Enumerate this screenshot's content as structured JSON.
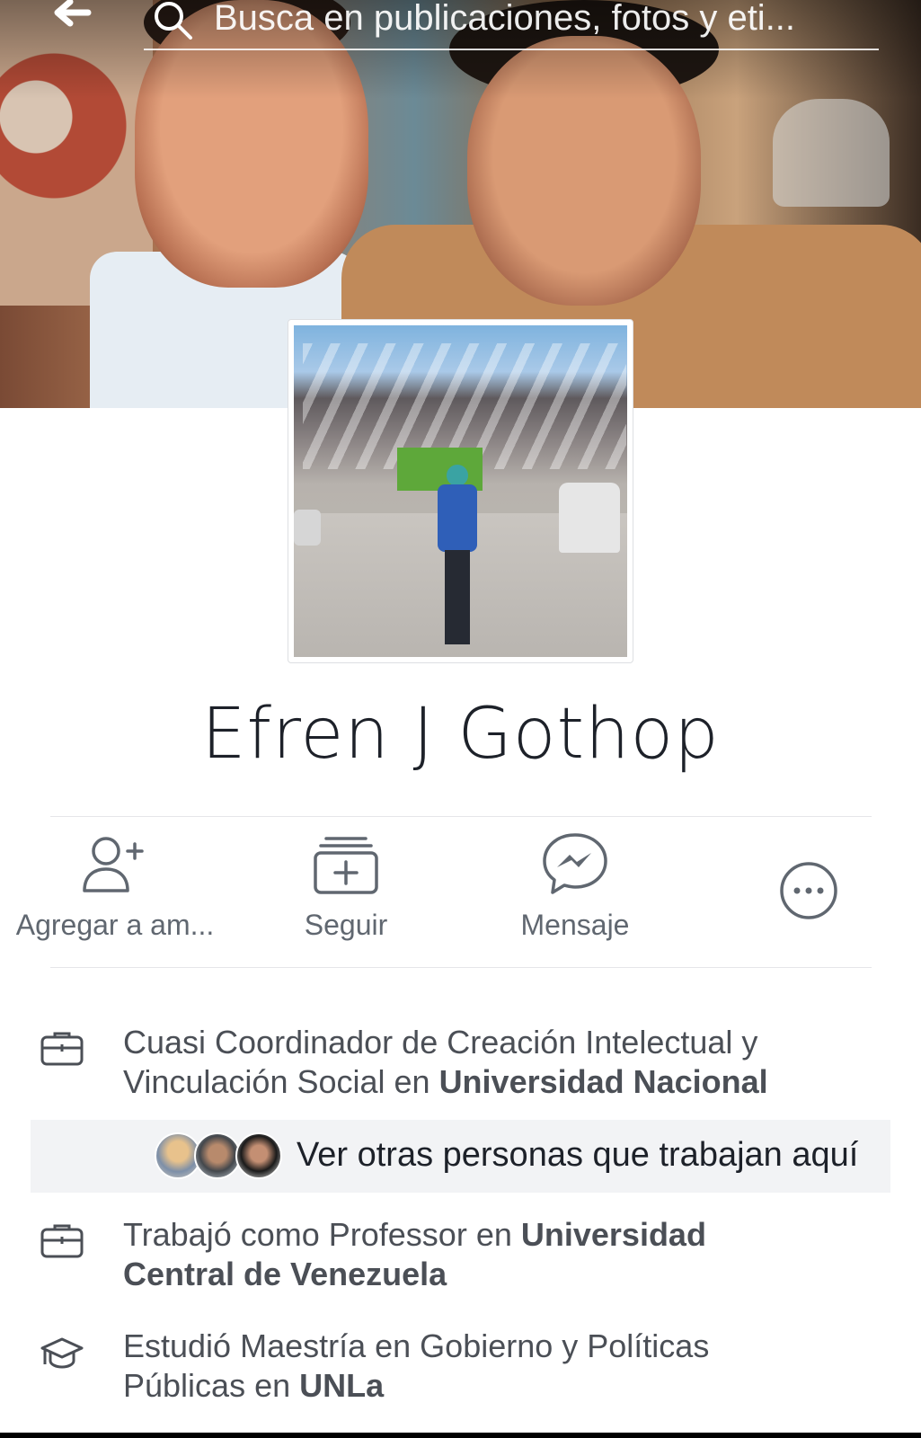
{
  "search": {
    "placeholder": "Busca en publicaciones, fotos y eti..."
  },
  "profile": {
    "name": "Efren J Gothop"
  },
  "actions": [
    {
      "label": "Agregar a am...",
      "icon": "add-friend-icon"
    },
    {
      "label": "Seguir",
      "icon": "follow-icon"
    },
    {
      "label": "Mensaje",
      "icon": "messenger-icon"
    },
    {
      "label": "",
      "icon": "more-icon"
    }
  ],
  "about": {
    "work_current": {
      "text_prefix": "Cuasi Coordinador de Creación Intelectual y Vinculación Social en ",
      "org": "Universidad Nacional",
      "icon": "briefcase-icon"
    },
    "coworkers_label": "Ver otras personas que trabajan aquí",
    "work_past": {
      "text_prefix": "Trabajó como Professor en ",
      "org": "Universidad Central de Venezuela",
      "icon": "briefcase-icon"
    },
    "education": {
      "text_prefix": "Estudió Maestría en Gobierno y Políticas Públicas en ",
      "org": "UNLa",
      "icon": "graduation-cap-icon"
    }
  },
  "colors": {
    "icon_gray": "#606770",
    "text_dark": "#1d2129",
    "divider": "#e5e6e9"
  }
}
